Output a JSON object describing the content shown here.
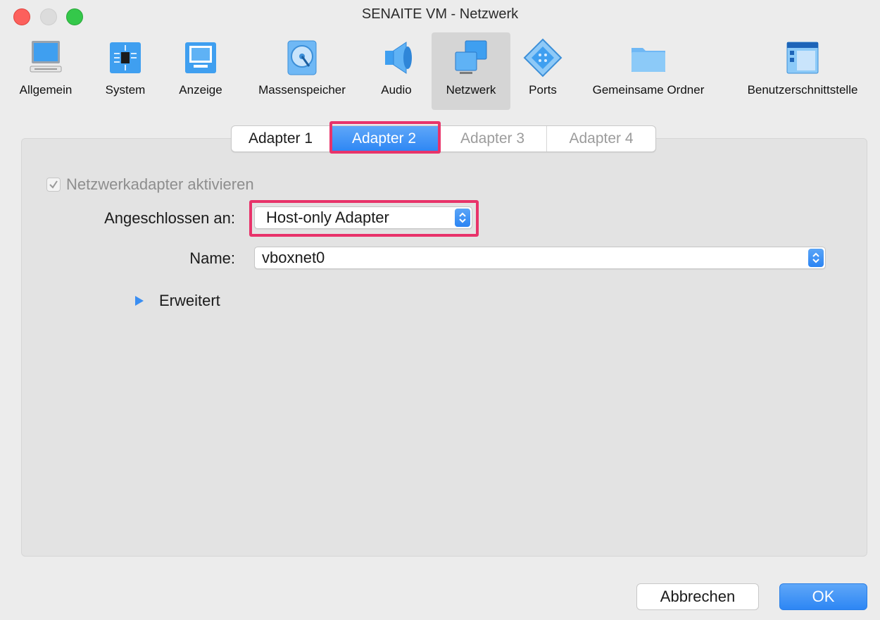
{
  "window": {
    "title": "SENAITE VM - Netzwerk"
  },
  "toolbar": {
    "items": [
      {
        "label": "Allgemein",
        "icon": "computer-icon"
      },
      {
        "label": "System",
        "icon": "chip-icon"
      },
      {
        "label": "Anzeige",
        "icon": "monitor-icon"
      },
      {
        "label": "Massenspeicher",
        "icon": "hard-disk-icon"
      },
      {
        "label": "Audio",
        "icon": "speaker-icon"
      },
      {
        "label": "Netzwerk",
        "icon": "network-icon",
        "selected": true
      },
      {
        "label": "Ports",
        "icon": "serial-port-icon"
      },
      {
        "label": "Gemeinsame Ordner",
        "icon": "folder-icon"
      },
      {
        "label": "Benutzerschnittstelle",
        "icon": "user-interface-icon"
      }
    ]
  },
  "adapter_tabs": [
    {
      "label": "Adapter 1",
      "state": "enabled"
    },
    {
      "label": "Adapter 2",
      "state": "selected"
    },
    {
      "label": "Adapter 3",
      "state": "disabled"
    },
    {
      "label": "Adapter 4",
      "state": "disabled"
    }
  ],
  "form": {
    "enable_adapter": {
      "label": "Netzwerkadapter aktivieren",
      "checked": true
    },
    "attached_to": {
      "label": "Angeschlossen an:",
      "value": "Host-only Adapter"
    },
    "name": {
      "label": "Name:",
      "value": "vboxnet0"
    },
    "advanced": {
      "label": "Erweitert"
    }
  },
  "buttons": {
    "cancel": "Abbrechen",
    "ok": "OK"
  },
  "colors": {
    "accent": "#2d86f4",
    "highlight": "#e8336a"
  }
}
